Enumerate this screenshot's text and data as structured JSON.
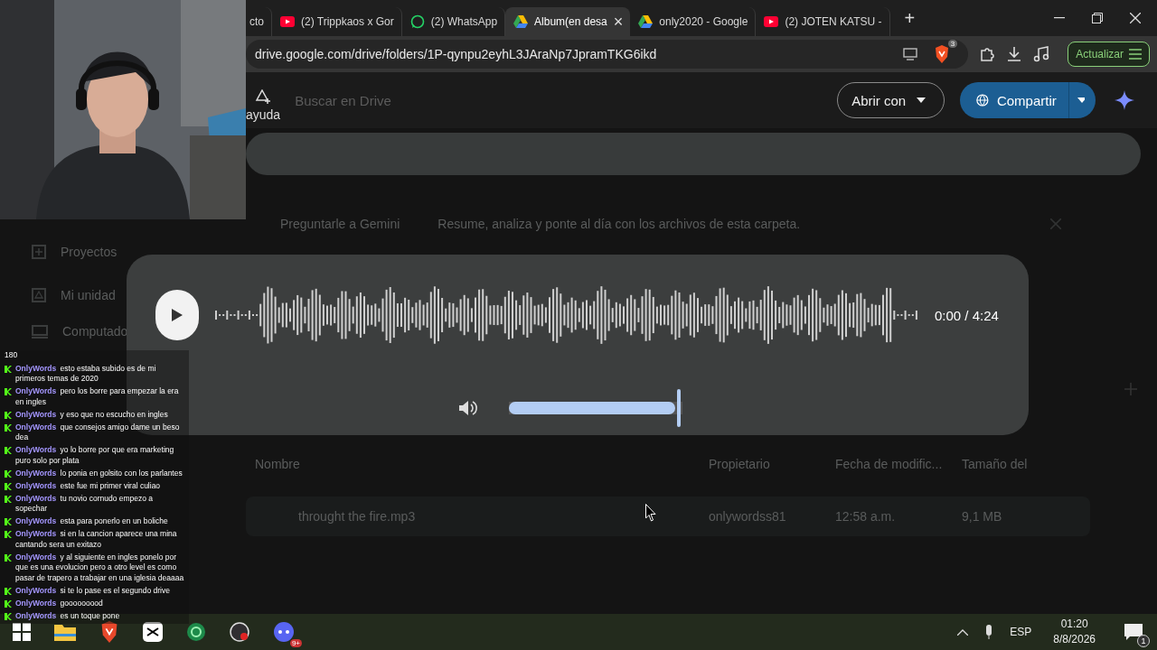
{
  "browser": {
    "tabs": [
      {
        "title": "cto",
        "kind": "plain",
        "selected": false
      },
      {
        "title": "(2) Trippkaos x Gor",
        "kind": "youtube",
        "selected": false
      },
      {
        "title": "(2) WhatsApp",
        "kind": "whatsapp",
        "selected": false
      },
      {
        "title": "Album(en desa",
        "kind": "drive",
        "selected": true,
        "close": "×"
      },
      {
        "title": "only2020 - Google",
        "kind": "drive",
        "selected": false
      },
      {
        "title": "(2) JOTEN KATSU -",
        "kind": "youtube",
        "selected": false
      }
    ],
    "new_tab": "+",
    "url": "drive.google.com/drive/folders/1P-qynpu2eyhL3JAraNp7JpramTKG6ikd",
    "shield_badge": "3",
    "update_button": "Actualizar"
  },
  "drive": {
    "help_label": "ayuda",
    "search": {
      "placeholder": "Buscar en Drive"
    },
    "open_with": "Abrir con",
    "share": "Compartir",
    "sidebar": [
      {
        "label": "Proyectos",
        "kind": "projects"
      },
      {
        "label": "Mi unidad",
        "kind": "drive"
      },
      {
        "label": "Computado",
        "kind": "computer"
      }
    ],
    "gemini": {
      "label": "Preguntarle a Gemini",
      "prompt": "Resume, analiza y ponte al día con los archivos de esta carpeta."
    },
    "table": {
      "columns": [
        "Nombre",
        "Propietario",
        "Fecha de modific...",
        "Tamaño del"
      ],
      "rows": [
        {
          "name": "throught the fire.mp3",
          "owner": "onlywordss81",
          "modified": "12:58 a.m.",
          "size": "9,1 MB"
        }
      ]
    }
  },
  "player": {
    "time": "0:00 / 4:24",
    "volume": {
      "level": 1.0
    }
  },
  "chat": {
    "count": "180",
    "messages": [
      {
        "user": "OnlyWords",
        "text": "esto estaba subido es de mi primeros temas de 2020"
      },
      {
        "user": "OnlyWords",
        "text": "pero los borre para empezar la era en ingles"
      },
      {
        "user": "OnlyWords",
        "text": "y eso que no escucho en ingles"
      },
      {
        "user": "OnlyWords",
        "text": "que consejos amigo dame un beso dea"
      },
      {
        "user": "OnlyWords",
        "text": "yo lo borre por que era marketing puro solo por plata"
      },
      {
        "user": "OnlyWords",
        "text": "lo ponia en golsito con los parlantes"
      },
      {
        "user": "OnlyWords",
        "text": "este fue mi primer viral culiao"
      },
      {
        "user": "OnlyWords",
        "text": "tu novio cornudo empezo a sopechar"
      },
      {
        "user": "OnlyWords",
        "text": "esta para ponerlo en un boliche"
      },
      {
        "user": "OnlyWords",
        "text": "si en la cancion aparece una mina cantando sera un exitazo"
      },
      {
        "user": "OnlyWords",
        "text": "y al siguiente en ingles ponelo por que es una evolucion pero a otro level es como pasar de trapero a trabajar en una iglesia deaaaa"
      },
      {
        "user": "OnlyWords",
        "text": "si te lo pase es el segundo drive"
      },
      {
        "user": "OnlyWords",
        "text": "gooooooood"
      },
      {
        "user": "OnlyWords",
        "text": "es un toque pone"
      }
    ]
  },
  "taskbar": {
    "apps": [
      {
        "kind": "windows"
      },
      {
        "kind": "folder"
      },
      {
        "kind": "shield"
      },
      {
        "kind": "capcut"
      },
      {
        "kind": "ring"
      },
      {
        "kind": "record"
      },
      {
        "kind": "chat",
        "badge": "9+"
      }
    ],
    "language": "ESP",
    "time": "01:20",
    "date": "8/8/2026",
    "notifications": "1"
  }
}
